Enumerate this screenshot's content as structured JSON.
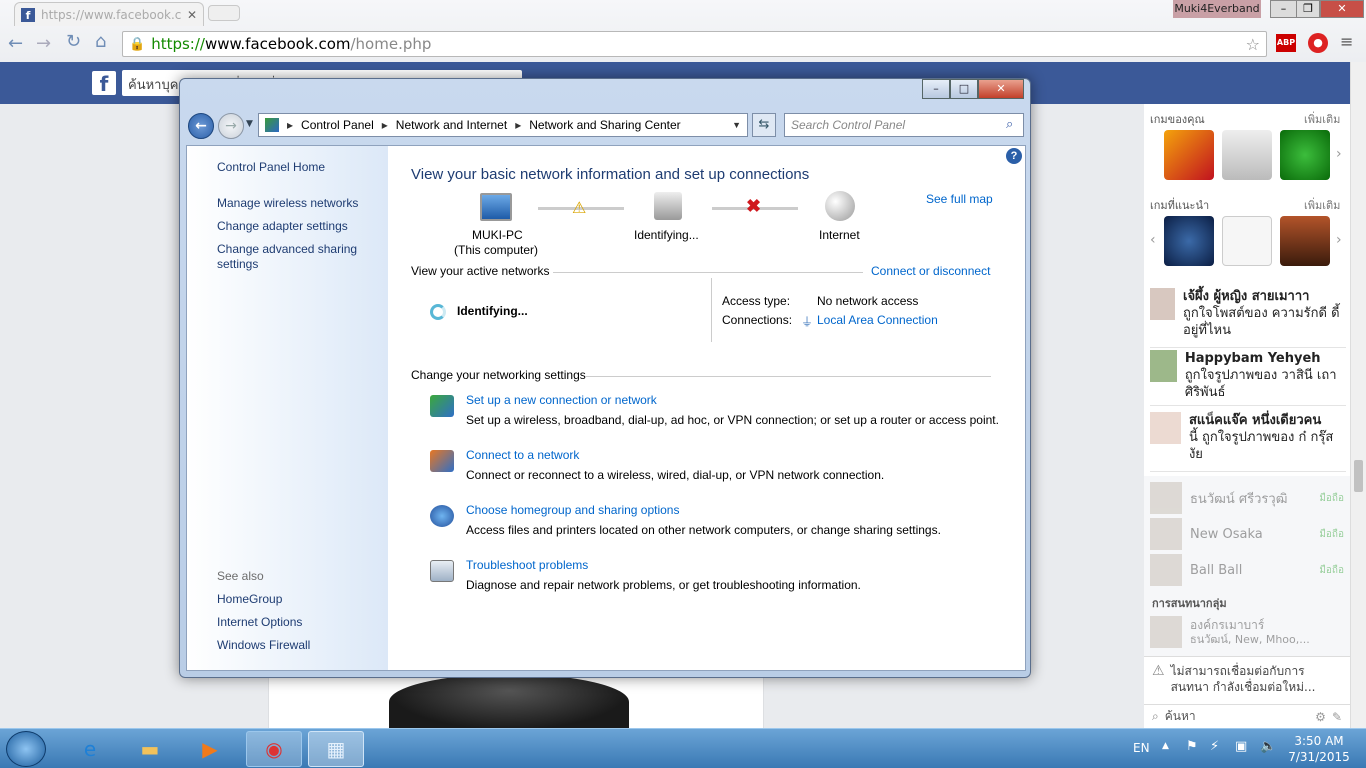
{
  "browser": {
    "tab_title": "https://www.facebook.co",
    "url_scheme": "https://",
    "url_host": "www.facebook.com",
    "url_path": "/home.php",
    "user_badge": "Muki4Everband",
    "abp_label": "ABP"
  },
  "facebook": {
    "logo": "f",
    "search_placeholder": "ค้นหาบุคคล สถานที่ และสิ่งต่างๆ",
    "games_title": "เกมของคุณ",
    "games_more": "เพิ่มเติม",
    "suggested_title": "เกมที่แนะนำ",
    "suggested_more": "เพิ่มเติม",
    "stories": [
      {
        "name": "เจ้ผึ้ง ผู้หญิง สายเมาาา",
        "text": "ถูกใจโพสต์ของ ความรักดี ดี้ อยู่ที่ไหน"
      },
      {
        "name": "Happybam Yehyeh",
        "text": "ถูกใจรูปภาพของ วาสินี เถาศิริพันธ์"
      },
      {
        "name": "สแน็คแจ๊ค หนึ่งเดียวคน",
        "text": "นี้ ถูกใจรูปภาพของ ก๋ กรุ๊ส งัย"
      }
    ],
    "chats": [
      {
        "name": "ธนวัฒน์ ศรีวรวุฒิ",
        "status": "มือถือ"
      },
      {
        "name": "New Osaka",
        "status": "มือถือ"
      },
      {
        "name": "Ball Ball",
        "status": "มือถือ"
      }
    ],
    "group_chat_title": "การสนทนากลุ่ม",
    "group_chat_name": "องค์กรเมาบาร์",
    "group_chat_members": "ธนวัฒน์, New, Mhoo,...",
    "chat_error": "ไม่สามารถเชื่อมต่อกับการสนทนา กำลังเชื่อมต่อใหม่...",
    "chat_search": "ค้นหา"
  },
  "window": {
    "breadcrumb": [
      "Control Panel",
      "Network and Internet",
      "Network and Sharing Center"
    ],
    "search_placeholder": "Search Control Panel",
    "left_links": [
      "Control Panel Home",
      "Manage wireless networks",
      "Change adapter settings",
      "Change advanced sharing settings"
    ],
    "see_also_title": "See also",
    "see_also": [
      "HomeGroup",
      "Internet Options",
      "Windows Firewall"
    ],
    "heading": "View your basic network information and set up connections",
    "see_full_map": "See full map",
    "nodes": [
      {
        "name": "MUKI-PC",
        "sub": "(This computer)"
      },
      {
        "name": "Identifying...",
        "sub": ""
      },
      {
        "name": "Internet",
        "sub": ""
      }
    ],
    "active_networks_title": "View your active networks",
    "connect_disconnect": "Connect or disconnect",
    "network_status": "Identifying...",
    "access_type_label": "Access type:",
    "access_type_value": "No network access",
    "connections_label": "Connections:",
    "connections_value": "Local Area Connection",
    "change_settings_title": "Change your networking settings",
    "tasks": [
      {
        "title": "Set up a new connection or network",
        "desc": "Set up a wireless, broadband, dial-up, ad hoc, or VPN connection; or set up a router or access point."
      },
      {
        "title": "Connect to a network",
        "desc": "Connect or reconnect to a wireless, wired, dial-up, or VPN network connection."
      },
      {
        "title": "Choose homegroup and sharing options",
        "desc": "Access files and printers located on other network computers, or change sharing settings."
      },
      {
        "title": "Troubleshoot problems",
        "desc": "Diagnose and repair network problems, or get troubleshooting information."
      }
    ]
  },
  "taskbar": {
    "language": "EN",
    "time": "3:50 AM",
    "date": "7/31/2015"
  }
}
